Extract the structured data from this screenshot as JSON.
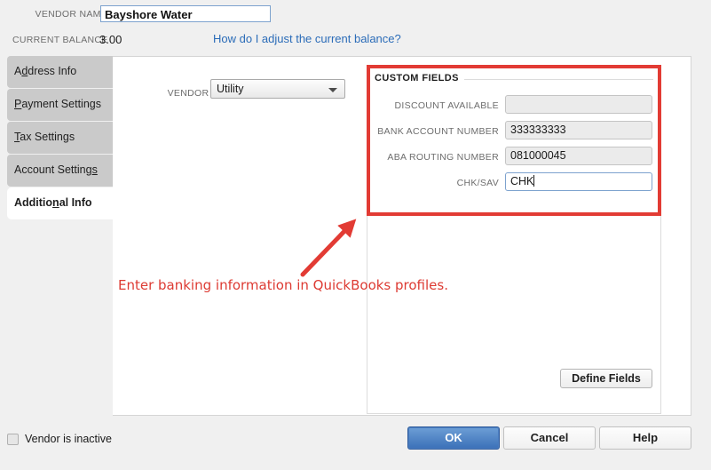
{
  "header": {
    "vendor_name_label": "VENDOR NAME",
    "vendor_name_value": "Bayshore Water",
    "current_balance_label": "CURRENT BALANCE",
    "current_balance_value": "3.00",
    "adjust_balance_link": "How do I adjust the current balance?"
  },
  "tabs": [
    {
      "label": "Address Info",
      "mnemonic_index": 1,
      "active": false
    },
    {
      "label": "Payment Settings",
      "mnemonic_index": 0,
      "active": false
    },
    {
      "label": "Tax Settings",
      "mnemonic_index": 0,
      "active": false
    },
    {
      "label": "Account Settings",
      "mnemonic_index": 14,
      "active": false
    },
    {
      "label": "Additional Info",
      "mnemonic_index": 8,
      "active": true
    }
  ],
  "tab_labels": {
    "address_info": "Address Info",
    "payment_settings": "Payment Settings",
    "tax_settings": "Tax Settings",
    "account_settings": "Account Settings",
    "additional_info": "Additional Info"
  },
  "main": {
    "vendor_type_label": "VENDOR TYPE",
    "vendor_type_value": "Utility",
    "vendor_type_options": [
      "Utility"
    ],
    "custom_fields": {
      "legend": "CUSTOM FIELDS",
      "rows": [
        {
          "label": "DISCOUNT AVAILABLE",
          "value": "",
          "focused": false,
          "disabled": true
        },
        {
          "label": "BANK ACCOUNT NUMBER",
          "value": "333333333",
          "focused": false,
          "disabled": false
        },
        {
          "label": "ABA ROUTING NUMBER",
          "value": "081000045",
          "focused": false,
          "disabled": false
        },
        {
          "label": "CHK/SAV",
          "value": "CHK",
          "focused": true,
          "disabled": false
        }
      ],
      "define_fields_label": "Define Fields"
    }
  },
  "annotation": {
    "text": "Enter banking information in QuickBooks profiles.",
    "color": "#dd3b33",
    "highlight_color": "#e23b34",
    "arrow": "up-right-arrow"
  },
  "footer": {
    "inactive_label": "Vendor is inactive",
    "inactive_checked": false,
    "ok_label": "OK",
    "cancel_label": "Cancel",
    "help_label": "Help"
  },
  "colors": {
    "accent_blue": "#3b70b8",
    "link_blue": "#2b6cb8",
    "annotation_red": "#e23b34",
    "window_gray": "#f0f0f0",
    "tab_gray": "#cacaca"
  },
  "cf_rows": {
    "r0": {
      "label": "DISCOUNT AVAILABLE",
      "value": ""
    },
    "r1": {
      "label": "BANK ACCOUNT NUMBER",
      "value": "333333333"
    },
    "r2": {
      "label": "ABA ROUTING NUMBER",
      "value": "081000045"
    },
    "r3": {
      "label": "CHK/SAV",
      "value": "CHK"
    }
  }
}
